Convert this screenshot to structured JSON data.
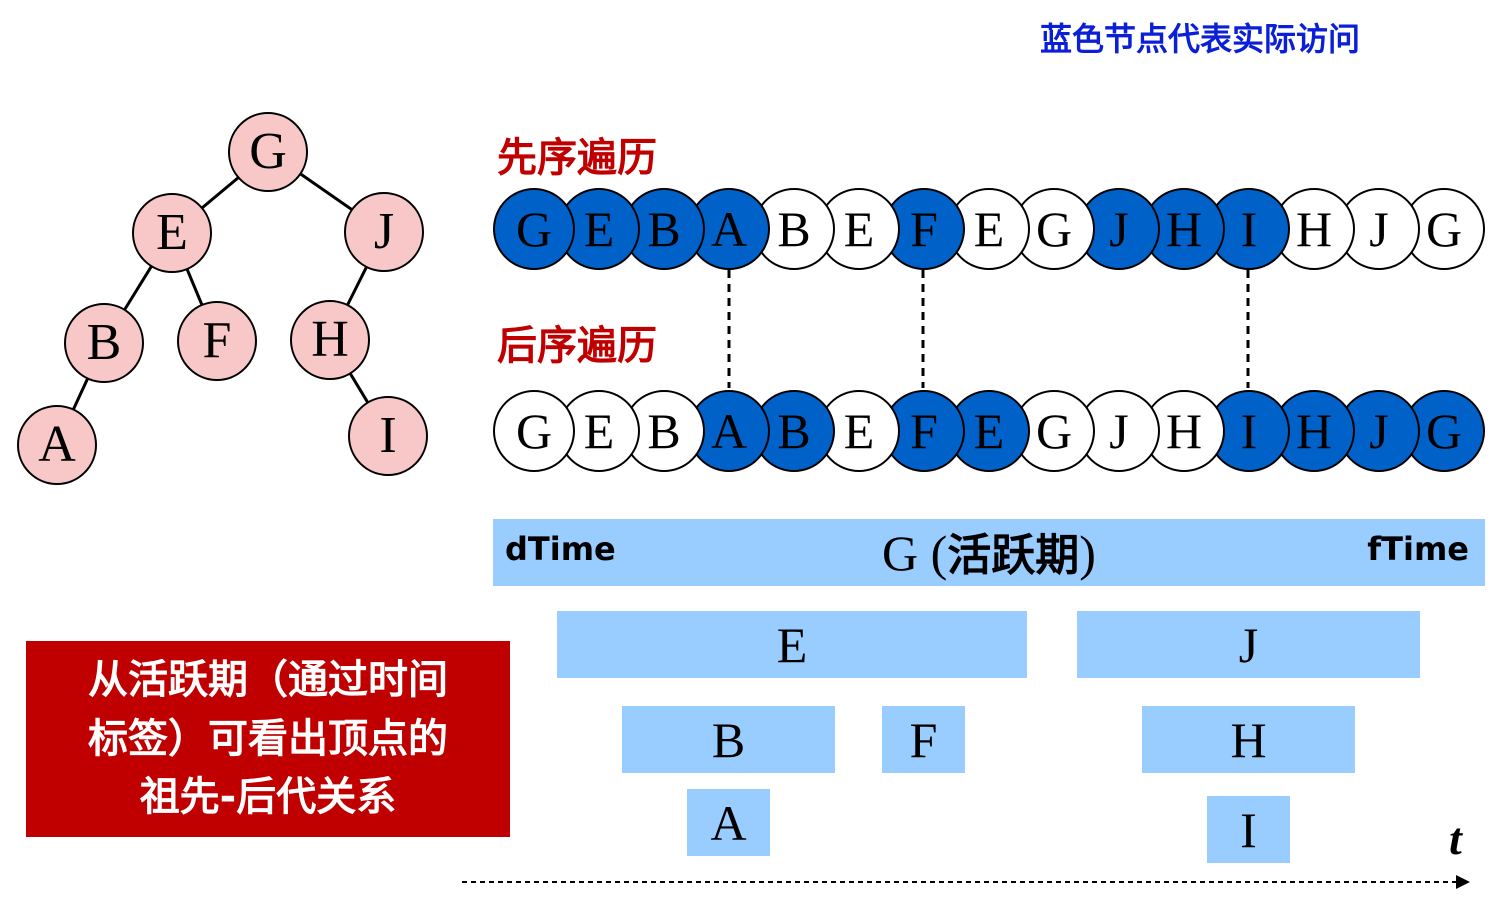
{
  "legend_note": "蓝色节点代表实际访问",
  "tree": {
    "nodes": [
      "G",
      "E",
      "J",
      "B",
      "F",
      "H",
      "A",
      "I"
    ]
  },
  "preorder": {
    "title": "先序遍历",
    "sequence": [
      {
        "label": "G",
        "visited": true
      },
      {
        "label": "E",
        "visited": true
      },
      {
        "label": "B",
        "visited": true
      },
      {
        "label": "A",
        "visited": true
      },
      {
        "label": "B",
        "visited": false
      },
      {
        "label": "E",
        "visited": false
      },
      {
        "label": "F",
        "visited": true
      },
      {
        "label": "E",
        "visited": false
      },
      {
        "label": "G",
        "visited": false
      },
      {
        "label": "J",
        "visited": true
      },
      {
        "label": "H",
        "visited": true
      },
      {
        "label": "I",
        "visited": true
      },
      {
        "label": "H",
        "visited": false
      },
      {
        "label": "J",
        "visited": false
      },
      {
        "label": "G",
        "visited": false
      }
    ]
  },
  "postorder": {
    "title": "后序遍历",
    "sequence": [
      {
        "label": "G",
        "visited": false
      },
      {
        "label": "E",
        "visited": false
      },
      {
        "label": "B",
        "visited": false
      },
      {
        "label": "A",
        "visited": true
      },
      {
        "label": "B",
        "visited": true
      },
      {
        "label": "E",
        "visited": false
      },
      {
        "label": "F",
        "visited": true
      },
      {
        "label": "E",
        "visited": true
      },
      {
        "label": "G",
        "visited": false
      },
      {
        "label": "J",
        "visited": false
      },
      {
        "label": "H",
        "visited": false
      },
      {
        "label": "I",
        "visited": true
      },
      {
        "label": "H",
        "visited": true
      },
      {
        "label": "J",
        "visited": true
      },
      {
        "label": "G",
        "visited": true
      }
    ]
  },
  "timeline": {
    "dtime": "dTime",
    "ftime": "fTime",
    "g_label": "G (",
    "g_bold": "活跃期",
    "g_close": ")",
    "bars": [
      "E",
      "J",
      "B",
      "F",
      "H",
      "A",
      "I"
    ],
    "axis_label": "t"
  },
  "callout": {
    "lines": [
      "从活跃期（通过时间",
      "标签）可看出顶点的",
      "祖先-后代关系"
    ]
  },
  "colors": {
    "tree_node": "#f8c8c8",
    "visited": "#0062c8",
    "bar": "#99ccff",
    "title_red": "#c00000",
    "note_blue": "#0b1fd6"
  }
}
